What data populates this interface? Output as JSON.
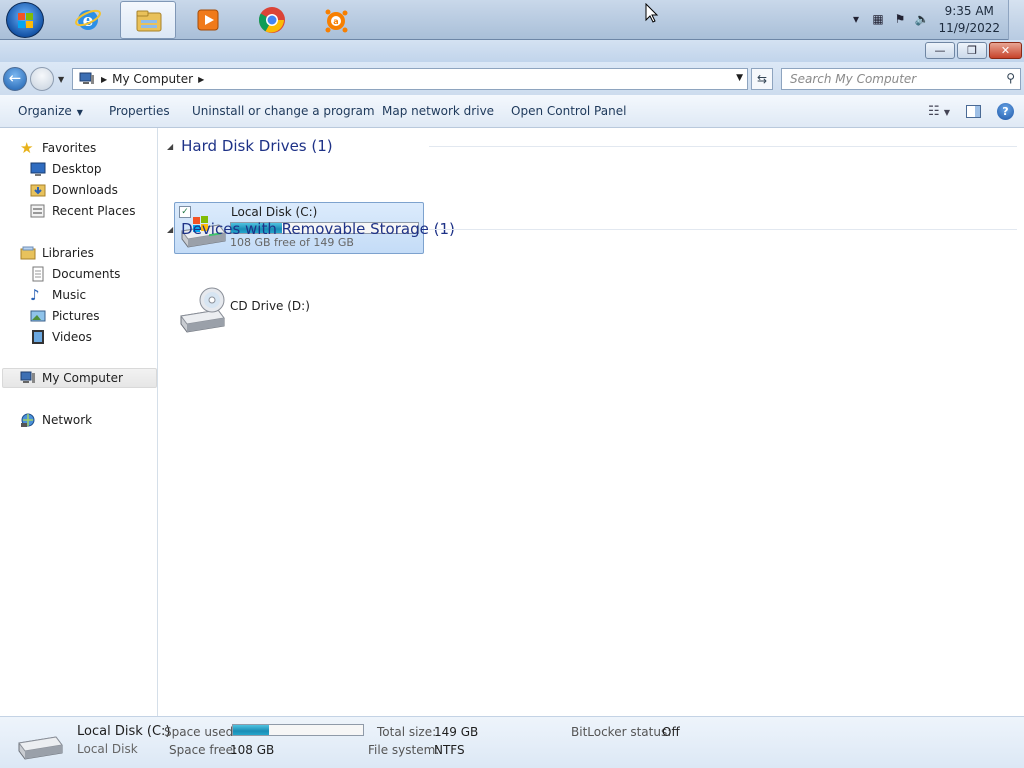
{
  "taskbar": {
    "clock_time": "9:35 AM",
    "clock_date": "11/9/2022",
    "pinned": [
      "windows-start-icon",
      "internet-explorer-icon",
      "windows-explorer-icon",
      "media-player-icon",
      "chrome-icon",
      "avast-icon"
    ]
  },
  "window": {
    "minimize": "—",
    "restore": "❐",
    "close": "✕"
  },
  "address": {
    "crumb": "My Computer",
    "search_placeholder": "Search My Computer"
  },
  "commands": {
    "organize": "Organize",
    "properties": "Properties",
    "uninstall": "Uninstall or change a program",
    "map_drive": "Map network drive",
    "control_panel": "Open Control Panel"
  },
  "nav": {
    "favorites": "Favorites",
    "desktop": "Desktop",
    "downloads": "Downloads",
    "recent": "Recent Places",
    "libraries": "Libraries",
    "documents": "Documents",
    "music": "Music",
    "pictures": "Pictures",
    "videos": "Videos",
    "computer": "My Computer",
    "network": "Network"
  },
  "groups": {
    "hdd": "Hard Disk Drives (1)",
    "removable": "Devices with Removable Storage (1)"
  },
  "drives": {
    "c_name": "Local Disk (C:)",
    "c_free": "108 GB free of 149 GB",
    "c_used_fraction": 0.275,
    "d_name": "CD Drive (D:)"
  },
  "status": {
    "name": "Local Disk (C:)",
    "type": "Local Disk",
    "space_used_label": "Space used:",
    "space_free_label": "Space free:",
    "space_free": "108 GB",
    "total_label": "Total size:",
    "total": "149 GB",
    "fs_label": "File system:",
    "fs": "NTFS",
    "bitlocker_label": "BitLocker status:",
    "bitlocker": "Off"
  },
  "colors": {
    "accent": "#1e3287",
    "selection": "#c4dcf7",
    "bar_fill": "#1a8db5"
  }
}
